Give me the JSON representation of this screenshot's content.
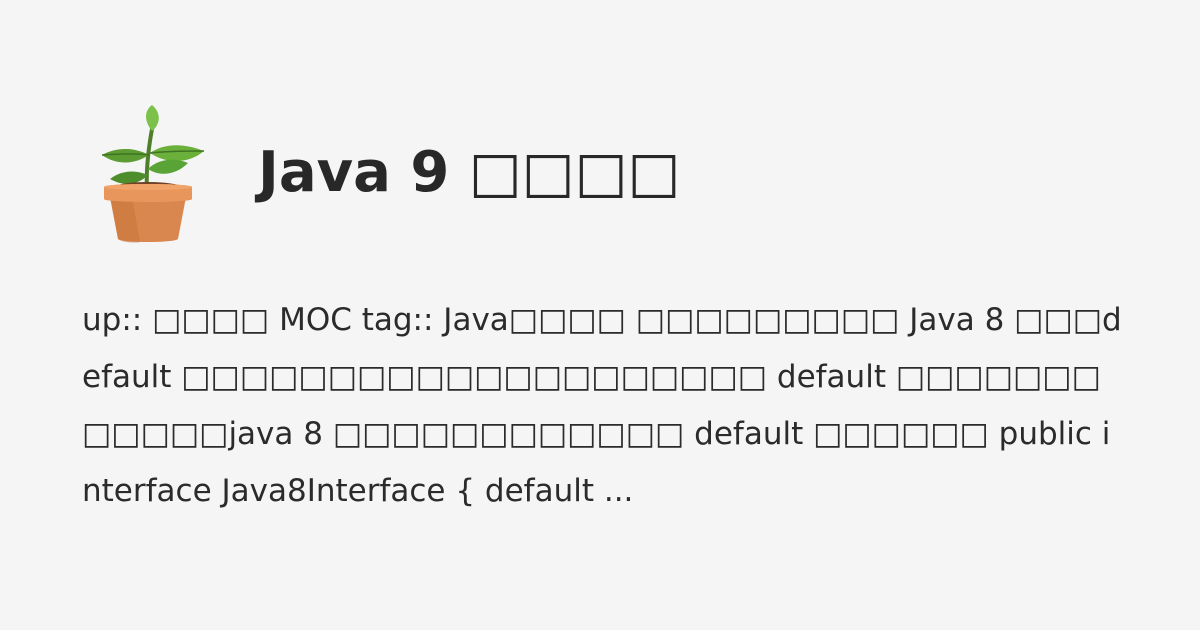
{
  "post": {
    "logo_icon": "potted-plant-icon",
    "title": "Java 9 □□□□",
    "excerpt": "up:: □□□□ MOC tag:: Java□□□□ □□□□□□□□□ Java 8 □□□default □□□□□□□□□□□□□□□□□□□□ default □□□□□□□□□□□□java 8 □□□□□□□□□□□□ default □□□□□□ public interface Java8Interface { default ..."
  },
  "colors": {
    "background": "#f6f5f6",
    "text": "#282828"
  }
}
